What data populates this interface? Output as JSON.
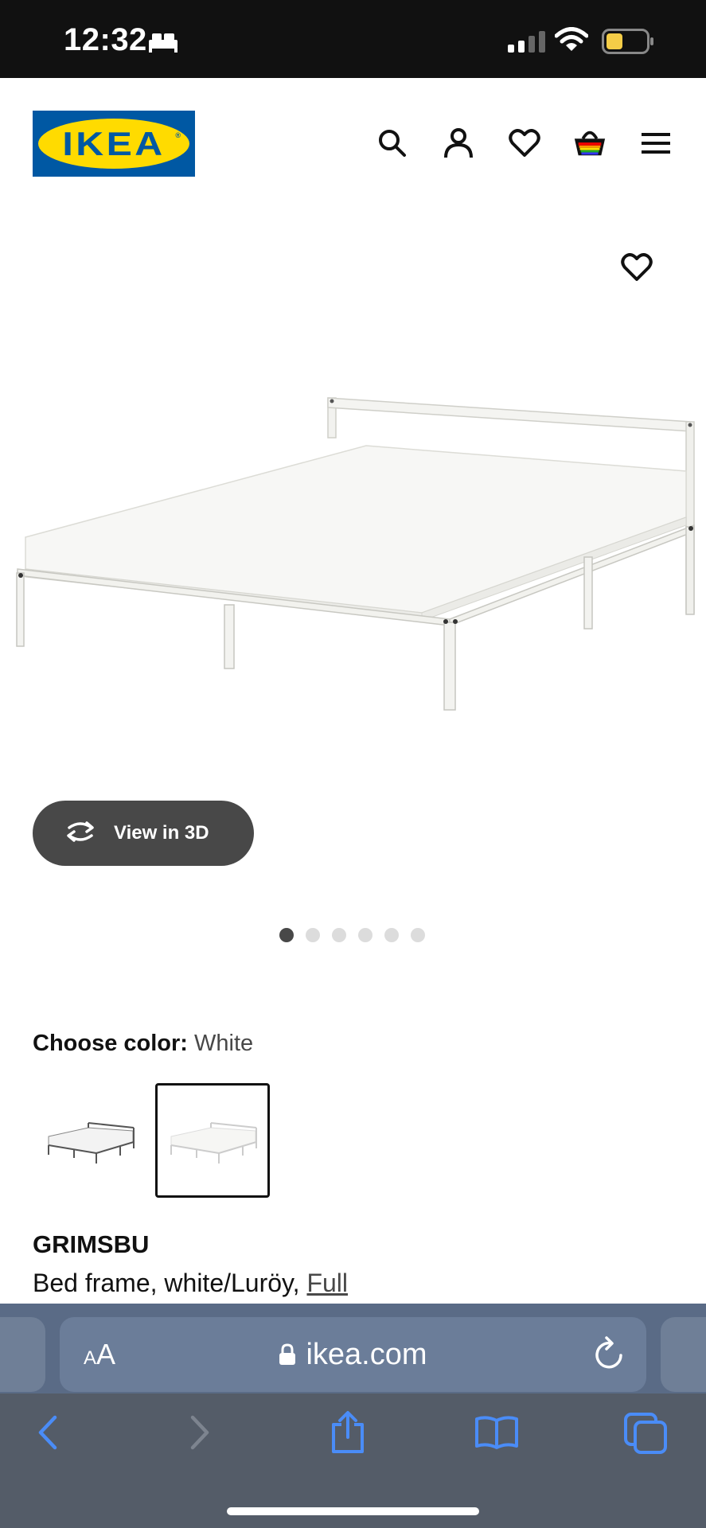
{
  "status_bar": {
    "time": "12:32"
  },
  "header": {
    "logo_text": "IKEA",
    "icons": [
      "search-icon",
      "account-icon",
      "favorites-icon",
      "shopping-bag-icon",
      "menu-icon"
    ]
  },
  "gallery": {
    "view_3d_label": "View in 3D",
    "image_count": 6,
    "active_index": 0
  },
  "product": {
    "choose_color_label": "Choose color:",
    "color_value": "White",
    "swatches": [
      "dark-gray",
      "white"
    ],
    "selected_swatch": 1,
    "name": "GRIMSBU",
    "description_prefix": "Bed frame, white/Luröy, ",
    "size_link": "Full"
  },
  "browser": {
    "aa_small": "A",
    "aa_large": "A",
    "url": "ikea.com"
  },
  "colors": {
    "ikea_blue": "#0058a3",
    "ikea_yellow": "#ffdb00",
    "dark_pill": "#484848",
    "safari_bar": "#5a6b86",
    "safari_icon": "#4a8cf7"
  }
}
